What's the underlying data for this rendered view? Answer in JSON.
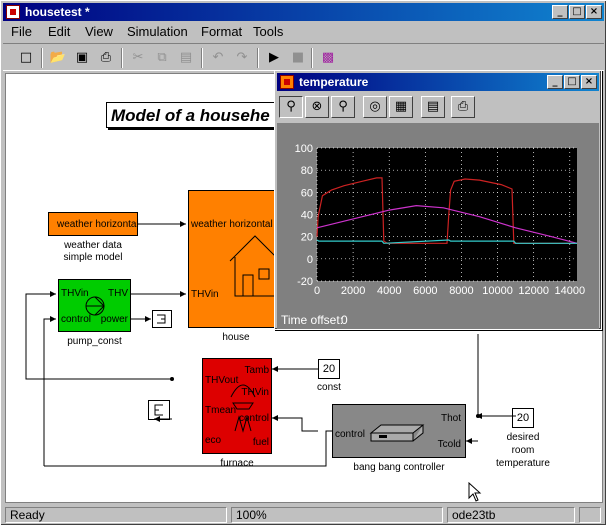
{
  "window": {
    "title": "housetest *",
    "controls": [
      "_",
      "□",
      "×"
    ]
  },
  "menu": [
    "File",
    "Edit",
    "View",
    "Simulation",
    "Format",
    "Tools"
  ],
  "toolbar": {
    "icons": [
      "new-icon",
      "open-icon",
      "save-icon",
      "print-icon",
      "cut-icon",
      "copy-icon",
      "paste-icon",
      "undo-icon",
      "redo-icon",
      "start-icon",
      "stop-icon",
      "library-icon"
    ]
  },
  "diagram": {
    "title": "Model of a househe",
    "blocks": {
      "weather": {
        "port_out": "weather  horizontal",
        "label_1": "weather data",
        "label_2": "simple model",
        "color": "#ff8000"
      },
      "house": {
        "port_in_1": "weather  horizontal",
        "port_in_2": "THVin",
        "label": "house",
        "color": "#ff8000"
      },
      "pump": {
        "port_in_1": "THVin",
        "port_in_2": "control",
        "port_out_1": "THV",
        "port_out_2": "power",
        "label": "pump_const",
        "color": "#00cc00"
      },
      "furnace": {
        "ports": [
          "THVout",
          "Tmean",
          "eco",
          "Tamb",
          "THVin",
          "control",
          "fuel"
        ],
        "label": "furnace",
        "color": "#dd0000"
      },
      "const": {
        "value": "20",
        "label": "const"
      },
      "controller": {
        "port_in": "control",
        "port_out_1": "Thot",
        "port_out_2": "Tcold",
        "label": "bang bang controller",
        "color": "#888888"
      },
      "desired": {
        "value": "20",
        "label_1": "desired",
        "label_2": "room",
        "label_3": "temperature"
      }
    }
  },
  "scope": {
    "title": "temperature",
    "time_offset_label": "Time offset:",
    "time_offset_value": "0",
    "tools": [
      "zoom-icon",
      "zoom-x-icon",
      "zoom-y-icon",
      "autoscale-icon",
      "save-axes-icon",
      "params-icon",
      "print-icon"
    ]
  },
  "chart_data": {
    "type": "line",
    "title": "",
    "xlabel": "",
    "ylabel": "",
    "xlim": [
      0,
      14400
    ],
    "ylim": [
      -20,
      100
    ],
    "xticks": [
      "0",
      "2000",
      "4000",
      "6000",
      "8000",
      "10000",
      "12000",
      "14000"
    ],
    "yticks": [
      "100",
      "80",
      "60",
      "40",
      "20",
      "0",
      "-20"
    ],
    "grid": true,
    "series": [
      {
        "color": "#cc2222",
        "x": [
          0,
          60,
          300,
          800,
          1500,
          2500,
          3300,
          3600,
          3700,
          3900,
          7200,
          7300,
          7400,
          7600,
          8200,
          9000,
          10200,
          10800,
          10900,
          11000,
          14400
        ],
        "y": [
          20,
          38,
          57,
          62,
          66,
          70,
          73,
          73,
          16,
          14,
          14,
          40,
          62,
          70,
          72,
          71,
          67,
          63,
          14,
          14,
          14
        ]
      },
      {
        "color": "#cc33cc",
        "x": [
          0,
          2000,
          4000,
          5500,
          7000,
          9000,
          11000,
          13000,
          14400
        ],
        "y": [
          28,
          36,
          44,
          48,
          46,
          38,
          28,
          20,
          14
        ]
      },
      {
        "color": "#33cccc",
        "x": [
          0,
          100,
          3600,
          3700,
          7300,
          7400,
          10900,
          11000,
          14400
        ],
        "y": [
          17,
          16,
          16,
          14,
          17,
          16,
          16,
          14,
          14
        ]
      }
    ]
  },
  "status": {
    "left": "Ready",
    "zoom": "100%",
    "solver": "ode23tb"
  }
}
